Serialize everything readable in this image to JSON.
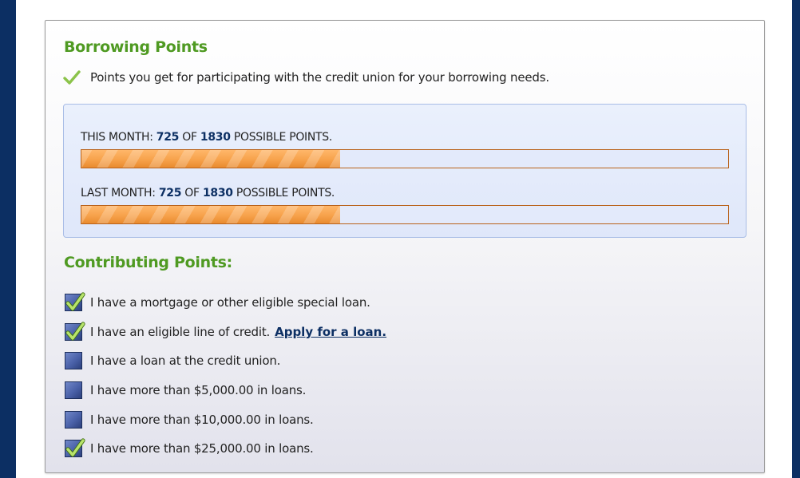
{
  "section": {
    "title": "Borrowing Points",
    "subtitle": "Points you get for participating with the credit union for your borrowing needs."
  },
  "points": {
    "this_month": {
      "prefix": "THIS MONTH:",
      "value": "725",
      "of_text": "OF",
      "total": "1830",
      "suffix": "POSSIBLE POINTS.",
      "progress": 0.4
    },
    "last_month": {
      "prefix": "LAST MONTH:",
      "value": "725",
      "of_text": "OF",
      "total": "1830",
      "suffix": "POSSIBLE POINTS.",
      "progress": 0.4
    }
  },
  "contributing": {
    "title": "Contributing Points:",
    "items": [
      {
        "label": "I have a mortgage or other eligible special loan.",
        "checked": true
      },
      {
        "label": "I have an eligible line of credit.",
        "checked": true,
        "link": "Apply for a loan."
      },
      {
        "label": "I have a loan at the credit union.",
        "checked": false
      },
      {
        "label": "I have more than $5,000.00 in loans.",
        "checked": false
      },
      {
        "label": "I have more than $10,000.00 in loans.",
        "checked": false
      },
      {
        "label": "I have more than $25,000.00 in loans.",
        "checked": true
      }
    ]
  },
  "colors": {
    "heading_green": "#4f9a22",
    "navy": "#0c2f63",
    "bar_orange": "#f7a24b",
    "check_green": "#8bc34a"
  },
  "icons": {
    "subtitle_icon": "checkmark-icon",
    "checkbox_checked": "checkbox-checked-icon",
    "checkbox_unchecked": "checkbox-unchecked-icon"
  }
}
